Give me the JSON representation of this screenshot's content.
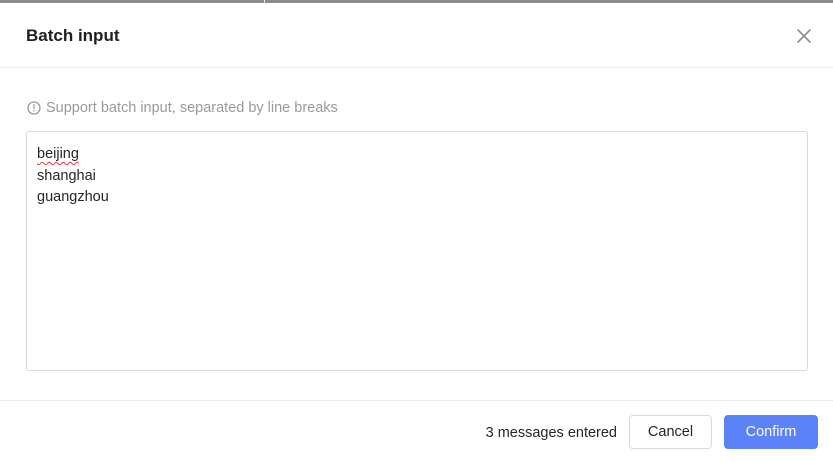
{
  "dialog": {
    "title": "Batch input",
    "close_icon": "close-icon",
    "hint_icon": "info-circle-icon",
    "hint": "Support batch input, separated by line breaks",
    "textarea": {
      "lines": [
        "beijing",
        "shanghai",
        "guangzhou"
      ]
    },
    "footer": {
      "count_text": "3 messages entered",
      "cancel_label": "Cancel",
      "confirm_label": "Confirm"
    },
    "colors": {
      "primary": "#5b82f6",
      "title": "#1f1f1f",
      "hint": "#9a9a9a",
      "border": "#d9d9d9",
      "spellcheck": "#e03a3a"
    }
  }
}
